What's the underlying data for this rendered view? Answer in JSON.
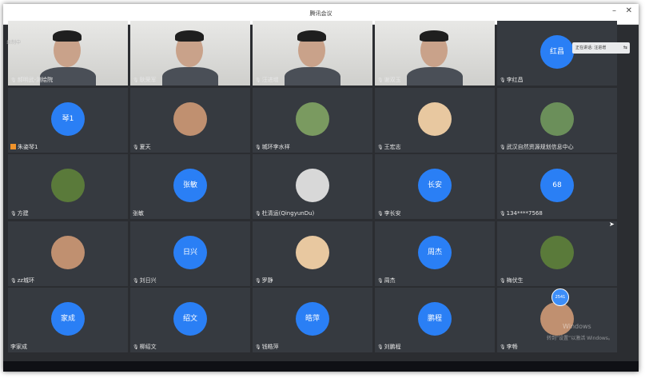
{
  "window": {
    "title": "腾讯会议"
  },
  "recording_label": "录制中",
  "speaking_tip": "正在讲话: 汪进增",
  "chat_badge": "2541",
  "watermark": {
    "line1": "Windows",
    "line2": "转到“设置”以激活 Windows。"
  },
  "colors": {
    "avatar": "#2a7ff5",
    "tile": "#363a40",
    "background": "#2b2d31",
    "accent_hand": "#f0932b"
  },
  "participants": [
    {
      "name": "郝明武-测绘院",
      "avatar": "",
      "type": "video",
      "mic": "mic-icon"
    },
    {
      "name": "耿荣军",
      "avatar": "",
      "type": "video",
      "mic": "mic-icon"
    },
    {
      "name": "汪进增",
      "avatar": "",
      "type": "video",
      "mic": "mic-icon"
    },
    {
      "name": "谢双玉",
      "avatar": "",
      "type": "video",
      "mic": "mic-icon"
    },
    {
      "name": "李红昌",
      "avatar": "红昌",
      "type": "avatar",
      "mic": "mic-icon"
    },
    {
      "name": "朱姿琴1",
      "avatar": "琴1",
      "type": "avatar",
      "mic": "hand-icon"
    },
    {
      "name": "夏天",
      "avatar": "",
      "type": "photo",
      "mic": "mic-icon"
    },
    {
      "name": "城环李水祥",
      "avatar": "",
      "type": "photo",
      "mic": "mic-icon"
    },
    {
      "name": "王宏志",
      "avatar": "",
      "type": "photo",
      "mic": "mic-icon"
    },
    {
      "name": "武汉自然资源规划信息中心",
      "avatar": "",
      "type": "photo",
      "mic": "mic-icon"
    },
    {
      "name": "方建",
      "avatar": "",
      "type": "photo",
      "mic": "mic-icon"
    },
    {
      "name": "张敏",
      "avatar": "张敏",
      "type": "avatar",
      "mic": "none"
    },
    {
      "name": "杜清运(QingyunDu)",
      "avatar": "",
      "type": "photo",
      "mic": "mic-icon"
    },
    {
      "name": "李长安",
      "avatar": "长安",
      "type": "avatar",
      "mic": "mic-icon"
    },
    {
      "name": "134****7568",
      "avatar": "68",
      "type": "avatar",
      "mic": "mic-icon"
    },
    {
      "name": "zz城环",
      "avatar": "",
      "type": "photo",
      "mic": "mic-icon"
    },
    {
      "name": "刘日兴",
      "avatar": "日兴",
      "type": "avatar",
      "mic": "mic-icon"
    },
    {
      "name": "罗静",
      "avatar": "",
      "type": "photo",
      "mic": "mic-icon"
    },
    {
      "name": "周杰",
      "avatar": "周杰",
      "type": "avatar",
      "mic": "mic-icon"
    },
    {
      "name": "梅伏生",
      "avatar": "",
      "type": "photo",
      "mic": "mic-icon"
    },
    {
      "name": "李家成",
      "avatar": "家成",
      "type": "avatar",
      "mic": "none"
    },
    {
      "name": "柳绍文",
      "avatar": "绍文",
      "type": "avatar",
      "mic": "mic-icon"
    },
    {
      "name": "钱皓萍",
      "avatar": "皓萍",
      "type": "avatar",
      "mic": "mic-icon"
    },
    {
      "name": "刘鹏程",
      "avatar": "鹏程",
      "type": "avatar",
      "mic": "mic-icon"
    },
    {
      "name": "李畅",
      "avatar": "",
      "type": "photo",
      "mic": "mic-icon"
    }
  ]
}
